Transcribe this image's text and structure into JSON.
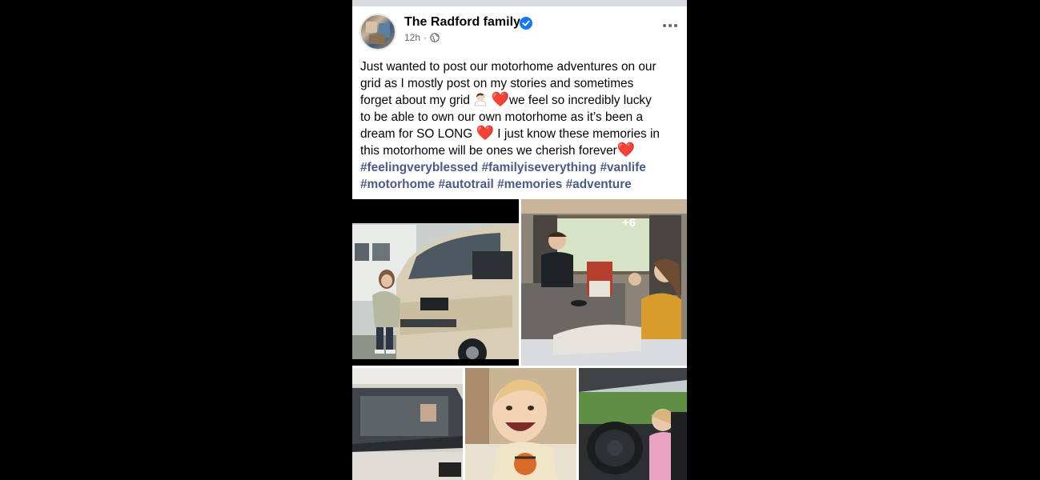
{
  "post": {
    "author": "The Radford family",
    "time": "12h",
    "separator": "·",
    "text_lines": [
      "Just wanted to post our motorhome adventures on our",
      "grid as I mostly post on my stories and sometimes",
      "forget about my grid",
      "we feel so incredibly lucky",
      "to be able to own our own motorhome as it’s  been a",
      "dream for SO LONG",
      " I just know these memories in",
      "this motorhome will be ones we cherish forever"
    ],
    "hashtags_line1": [
      "#feelingveryblessed",
      "#familyiseverything",
      "#vanlife"
    ],
    "hashtags_line2": [
      "#motorhome",
      "#autotrail",
      "#memories",
      "#adventure"
    ],
    "heart": "❤️",
    "more_photos_count": "+6"
  },
  "colors": {
    "background": "#000000",
    "card": "#ffffff",
    "hashtag": "#4b5a87",
    "verified": "#1877f2",
    "heart": "#e0243a"
  },
  "icons": [
    "verified-badge-icon",
    "globe-icon",
    "more-options-icon",
    "woman-facepalming-emoji",
    "red-heart-emoji"
  ]
}
